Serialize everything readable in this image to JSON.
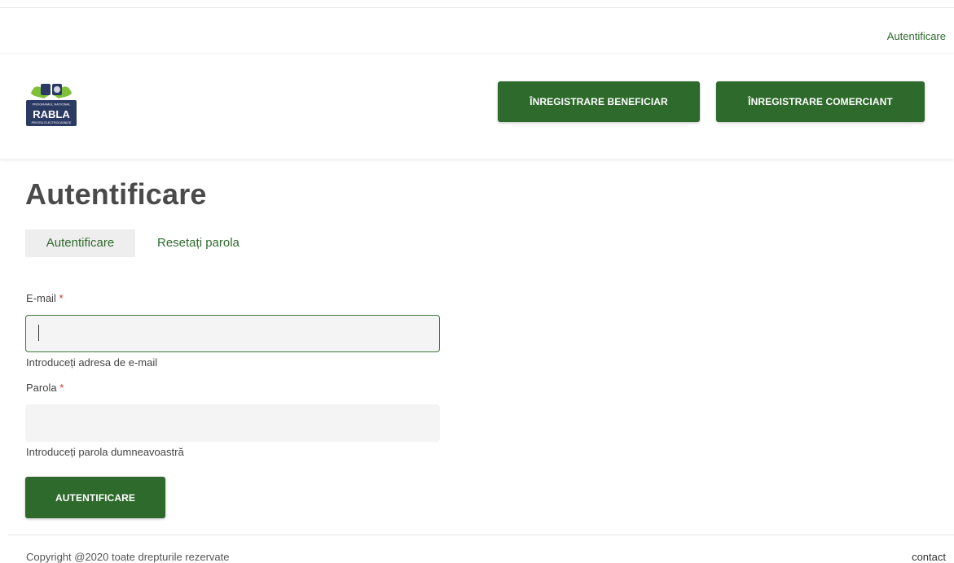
{
  "top_nav": {
    "login_link": "Autentificare"
  },
  "logo": {
    "alt": "Programul național Rabla pentru electrocasnice",
    "top_text": "PROGRAMUL NAȚIONAL",
    "main_text": "RABLA",
    "bottom_text": "PENTRU ELECTROCASNICE",
    "colors": {
      "navy": "#2b3a63",
      "leaf": "#7fbf3a"
    }
  },
  "header": {
    "register_beneficiary_label": "ÎNREGISTRARE BENEFICIAR",
    "register_merchant_label": "ÎNREGISTRARE COMERCIANT"
  },
  "main": {
    "title": "Autentificare",
    "tabs": [
      {
        "label": "Autentificare",
        "active": true
      },
      {
        "label": "Resetați parola",
        "active": false
      }
    ],
    "form": {
      "email_label": "E-mail",
      "email_value": "",
      "email_help": "Introduceți adresa de e-mail",
      "password_label": "Parola",
      "password_value": "",
      "password_help": "Introduceți parola dumneavoastră",
      "required_marker": "*",
      "submit_label": "AUTENTIFICARE"
    }
  },
  "footer": {
    "copyright": "Copyright @2020 toate drepturile rezervate",
    "contact": "contact"
  },
  "colors": {
    "primary_green": "#2d6a2b",
    "link_green": "#2e6b2e",
    "required_red": "#d0342c",
    "input_bg": "#f4f4f4"
  }
}
